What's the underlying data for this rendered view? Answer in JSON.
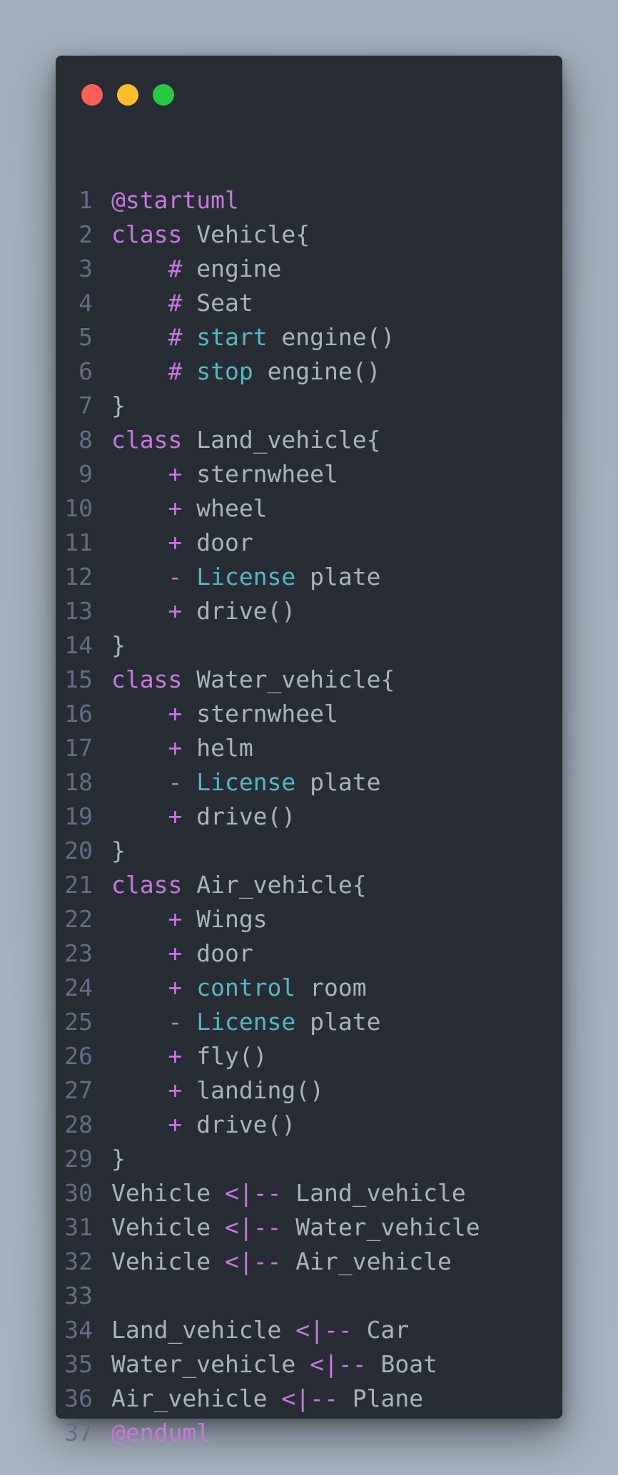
{
  "window": {
    "controls": [
      {
        "name": "close",
        "color": "#ff5f56"
      },
      {
        "name": "minimize",
        "color": "#ffbd2e"
      },
      {
        "name": "maximize",
        "color": "#27c93f"
      }
    ]
  },
  "colors": {
    "background": "#282c34",
    "keyword": "#c678dd",
    "cyan": "#56b6c2",
    "text": "#abb2bf",
    "line_number": "#636d83"
  },
  "code": {
    "lines": [
      {
        "num": "1",
        "tokens": [
          {
            "t": "@startuml",
            "c": "kw"
          }
        ]
      },
      {
        "num": "2",
        "tokens": [
          {
            "t": "class",
            "c": "kw"
          },
          {
            "t": " Vehicle{",
            "c": "pl"
          }
        ]
      },
      {
        "num": "3",
        "tokens": [
          {
            "t": "    #",
            "c": "kw"
          },
          {
            "t": " engine",
            "c": "pl"
          }
        ]
      },
      {
        "num": "4",
        "tokens": [
          {
            "t": "    #",
            "c": "kw"
          },
          {
            "t": " Seat",
            "c": "pl"
          }
        ]
      },
      {
        "num": "5",
        "tokens": [
          {
            "t": "    #",
            "c": "kw"
          },
          {
            "t": " ",
            "c": "pl"
          },
          {
            "t": "start",
            "c": "cy"
          },
          {
            "t": " engine()",
            "c": "pl"
          }
        ]
      },
      {
        "num": "6",
        "tokens": [
          {
            "t": "    #",
            "c": "kw"
          },
          {
            "t": " ",
            "c": "pl"
          },
          {
            "t": "stop",
            "c": "cy"
          },
          {
            "t": " engine()",
            "c": "pl"
          }
        ]
      },
      {
        "num": "7",
        "tokens": [
          {
            "t": "}",
            "c": "pl"
          }
        ]
      },
      {
        "num": "8",
        "tokens": [
          {
            "t": "class",
            "c": "kw"
          },
          {
            "t": " Land_vehicle{",
            "c": "pl"
          }
        ]
      },
      {
        "num": "9",
        "tokens": [
          {
            "t": "    +",
            "c": "kw"
          },
          {
            "t": " sternwheel",
            "c": "pl"
          }
        ]
      },
      {
        "num": "10",
        "tokens": [
          {
            "t": "    +",
            "c": "kw"
          },
          {
            "t": " wheel",
            "c": "pl"
          }
        ]
      },
      {
        "num": "11",
        "tokens": [
          {
            "t": "    +",
            "c": "kw"
          },
          {
            "t": " door",
            "c": "pl"
          }
        ]
      },
      {
        "num": "12",
        "tokens": [
          {
            "t": "    -",
            "c": "kw"
          },
          {
            "t": " ",
            "c": "pl"
          },
          {
            "t": "License",
            "c": "cy"
          },
          {
            "t": " plate",
            "c": "pl"
          }
        ]
      },
      {
        "num": "13",
        "tokens": [
          {
            "t": "    +",
            "c": "kw"
          },
          {
            "t": " drive()",
            "c": "pl"
          }
        ]
      },
      {
        "num": "14",
        "tokens": [
          {
            "t": "}",
            "c": "pl"
          }
        ]
      },
      {
        "num": "15",
        "tokens": [
          {
            "t": "class",
            "c": "kw"
          },
          {
            "t": " Water_vehicle{",
            "c": "pl"
          }
        ]
      },
      {
        "num": "16",
        "tokens": [
          {
            "t": "    +",
            "c": "kw"
          },
          {
            "t": " sternwheel",
            "c": "pl"
          }
        ]
      },
      {
        "num": "17",
        "tokens": [
          {
            "t": "    +",
            "c": "kw"
          },
          {
            "t": " helm",
            "c": "pl"
          }
        ]
      },
      {
        "num": "18",
        "tokens": [
          {
            "t": "    -",
            "c": "kw"
          },
          {
            "t": " ",
            "c": "pl"
          },
          {
            "t": "License",
            "c": "cy"
          },
          {
            "t": " plate",
            "c": "pl"
          }
        ]
      },
      {
        "num": "19",
        "tokens": [
          {
            "t": "    +",
            "c": "kw"
          },
          {
            "t": " drive()",
            "c": "pl"
          }
        ]
      },
      {
        "num": "20",
        "tokens": [
          {
            "t": "}",
            "c": "pl"
          }
        ]
      },
      {
        "num": "21",
        "tokens": [
          {
            "t": "class",
            "c": "kw"
          },
          {
            "t": " Air_vehicle{",
            "c": "pl"
          }
        ]
      },
      {
        "num": "22",
        "tokens": [
          {
            "t": "    +",
            "c": "kw"
          },
          {
            "t": " Wings",
            "c": "pl"
          }
        ]
      },
      {
        "num": "23",
        "tokens": [
          {
            "t": "    +",
            "c": "kw"
          },
          {
            "t": " door",
            "c": "pl"
          }
        ]
      },
      {
        "num": "24",
        "tokens": [
          {
            "t": "    +",
            "c": "kw"
          },
          {
            "t": " ",
            "c": "pl"
          },
          {
            "t": "control",
            "c": "cy"
          },
          {
            "t": " room",
            "c": "pl"
          }
        ]
      },
      {
        "num": "25",
        "tokens": [
          {
            "t": "    -",
            "c": "kw"
          },
          {
            "t": " ",
            "c": "pl"
          },
          {
            "t": "License",
            "c": "cy"
          },
          {
            "t": " plate",
            "c": "pl"
          }
        ]
      },
      {
        "num": "26",
        "tokens": [
          {
            "t": "    +",
            "c": "kw"
          },
          {
            "t": " fly()",
            "c": "pl"
          }
        ]
      },
      {
        "num": "27",
        "tokens": [
          {
            "t": "    +",
            "c": "kw"
          },
          {
            "t": " landing()",
            "c": "pl"
          }
        ]
      },
      {
        "num": "28",
        "tokens": [
          {
            "t": "    +",
            "c": "kw"
          },
          {
            "t": " drive()",
            "c": "pl"
          }
        ]
      },
      {
        "num": "29",
        "tokens": [
          {
            "t": "}",
            "c": "pl"
          }
        ]
      },
      {
        "num": "30",
        "tokens": [
          {
            "t": "Vehicle ",
            "c": "pl"
          },
          {
            "t": "<|--",
            "c": "kw"
          },
          {
            "t": " Land_vehicle",
            "c": "pl"
          }
        ]
      },
      {
        "num": "31",
        "tokens": [
          {
            "t": "Vehicle ",
            "c": "pl"
          },
          {
            "t": "<|--",
            "c": "kw"
          },
          {
            "t": " Water_vehicle",
            "c": "pl"
          }
        ]
      },
      {
        "num": "32",
        "tokens": [
          {
            "t": "Vehicle ",
            "c": "pl"
          },
          {
            "t": "<|--",
            "c": "kw"
          },
          {
            "t": " Air_vehicle",
            "c": "pl"
          }
        ]
      },
      {
        "num": "33",
        "tokens": []
      },
      {
        "num": "34",
        "tokens": [
          {
            "t": "Land_vehicle ",
            "c": "pl"
          },
          {
            "t": "<|--",
            "c": "kw"
          },
          {
            "t": " Car",
            "c": "pl"
          }
        ]
      },
      {
        "num": "35",
        "tokens": [
          {
            "t": "Water_vehicle ",
            "c": "pl"
          },
          {
            "t": "<|--",
            "c": "kw"
          },
          {
            "t": " Boat",
            "c": "pl"
          }
        ]
      },
      {
        "num": "36",
        "tokens": [
          {
            "t": "Air_vehicle ",
            "c": "pl"
          },
          {
            "t": "<|--",
            "c": "kw"
          },
          {
            "t": " Plane",
            "c": "pl"
          }
        ]
      },
      {
        "num": "37",
        "tokens": [
          {
            "t": "@enduml",
            "c": "kw"
          }
        ]
      }
    ]
  }
}
